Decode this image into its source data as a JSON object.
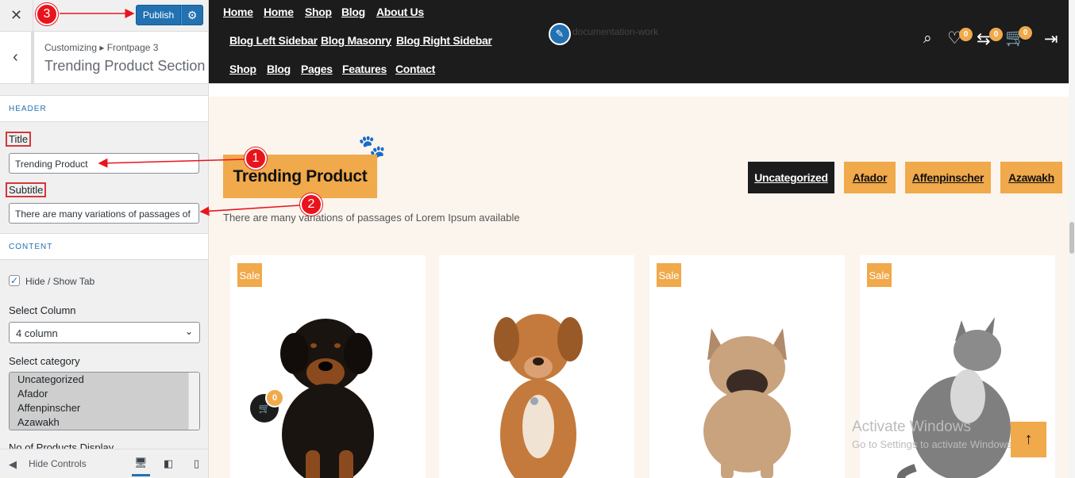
{
  "sidebar": {
    "close_glyph": "✕",
    "publish_label": "Publish",
    "breadcrumb": "Customizing ▸ Frontpage 3",
    "section_title": "Trending Product Section",
    "header_group": "HEADER",
    "title_label": "Title",
    "title_value": "Trending Product",
    "subtitle_label": "Subtitle",
    "subtitle_value": "There are many variations of passages of",
    "content_group": "CONTENT",
    "hide_show_tab_label": "Hide / Show Tab",
    "hide_show_tab_checked": true,
    "select_column_label": "Select Column",
    "select_column_value": "4 column",
    "select_category_label": "Select category",
    "categories": [
      "Uncategorized",
      "Afador",
      "Affenpinscher",
      "Azawakh"
    ],
    "products_display_label": "No of Products Display",
    "hide_controls_label": "Hide Controls"
  },
  "header": {
    "nav_row1": [
      "Home",
      "Home",
      "Shop",
      "Blog",
      "About Us"
    ],
    "nav_row2": [
      "Blog Left Sidebar",
      "Blog Masonry",
      "Blog Right Sidebar"
    ],
    "nav_row3": [
      "Shop",
      "Blog",
      "Pages",
      "Features",
      "Contact"
    ],
    "logo_alt": "documentation-work",
    "wishlist_count": "0",
    "compare_count": "0",
    "cart_count": "0"
  },
  "section": {
    "title": "Trending Product",
    "subtitle": "There are many variations of passages of Lorem Ipsum available",
    "tabs": [
      "Uncategorized",
      "Afador",
      "Affenpinscher",
      "Azawakh"
    ],
    "active_tab": "Uncategorized"
  },
  "products": [
    {
      "badge": "Sale",
      "icon": "rottweiler-puppy-image"
    },
    {
      "badge": "",
      "icon": "brown-dog-image"
    },
    {
      "badge": "Sale",
      "icon": "french-bulldog-image"
    },
    {
      "badge": "Sale",
      "icon": "kitten-image"
    }
  ],
  "floating_cart_count": "0",
  "watermark": {
    "line1": "Activate Windows",
    "line2": "Go to Settings to activate Windows."
  },
  "annotations": [
    "1",
    "2",
    "3"
  ],
  "colors": {
    "accent": "#f0a94b",
    "dark": "#1c1c1c",
    "wp_blue": "#2271b1",
    "annotation_red": "#e8141c"
  }
}
